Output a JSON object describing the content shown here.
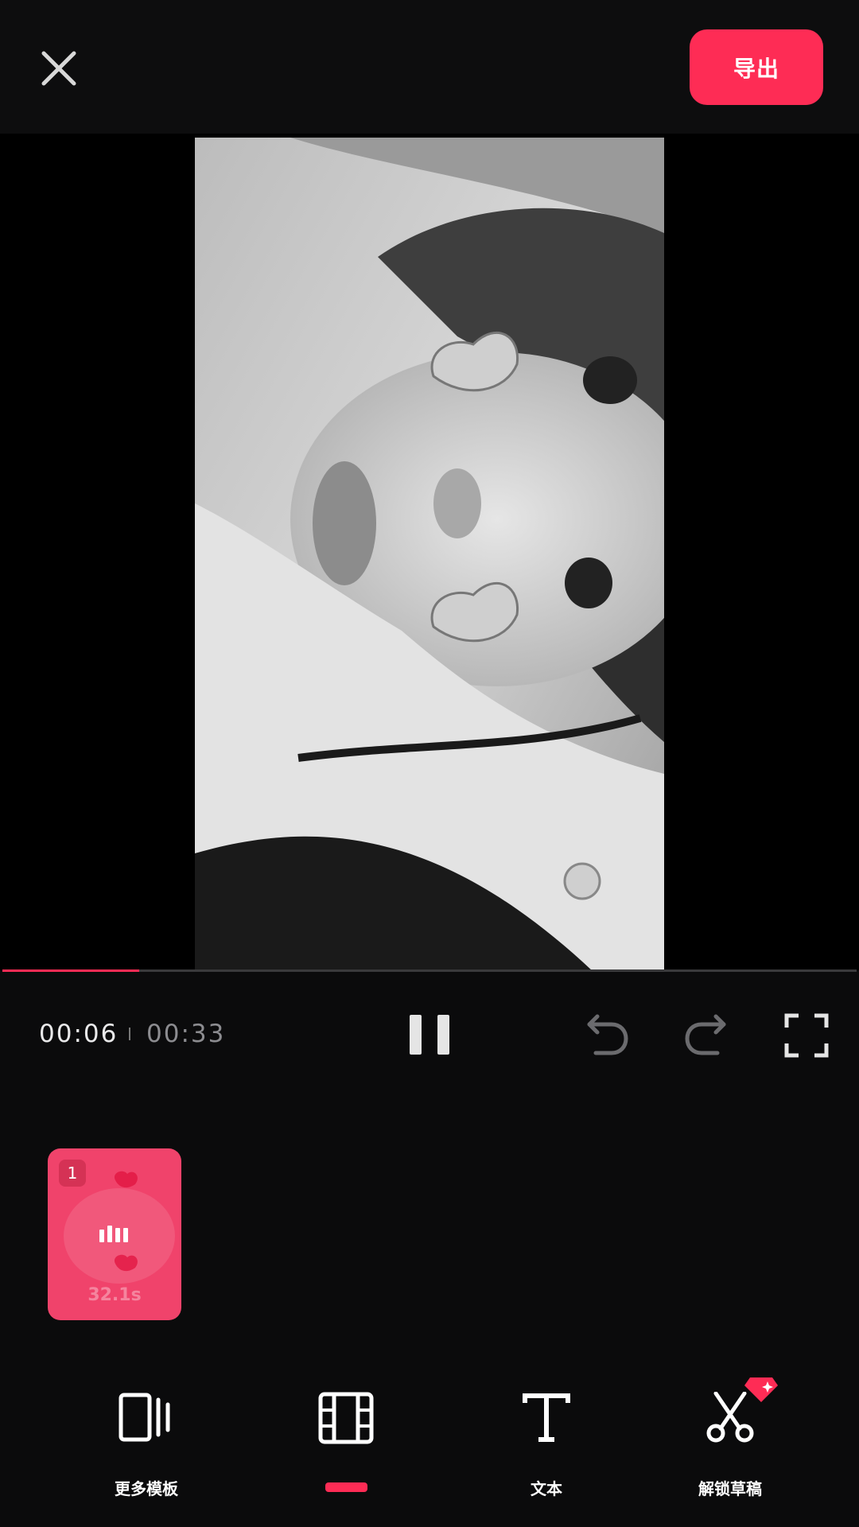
{
  "header": {
    "close_icon": "close-icon",
    "export_label": "导出",
    "accent_color": "#fe2c55"
  },
  "player": {
    "current_time": "00:06",
    "total_time": "00:33",
    "progress": 0.16,
    "pause_icon": "pause-icon",
    "undo_icon": "undo-icon",
    "redo_icon": "redo-icon",
    "fullscreen_icon": "fullscreen-icon"
  },
  "timeline": {
    "clips": [
      {
        "index": "1",
        "duration": "32.1s",
        "icon": "adjust-icon"
      }
    ]
  },
  "toolbar": {
    "items": [
      {
        "label": "更多模板",
        "icon": "template-icon"
      },
      {
        "label": "",
        "icon": "film-icon",
        "active": true
      },
      {
        "label": "文本",
        "icon": "text-icon"
      },
      {
        "label": "解锁草稿",
        "icon": "scissors-icon",
        "badge_icon": "diamond-icon"
      }
    ]
  }
}
